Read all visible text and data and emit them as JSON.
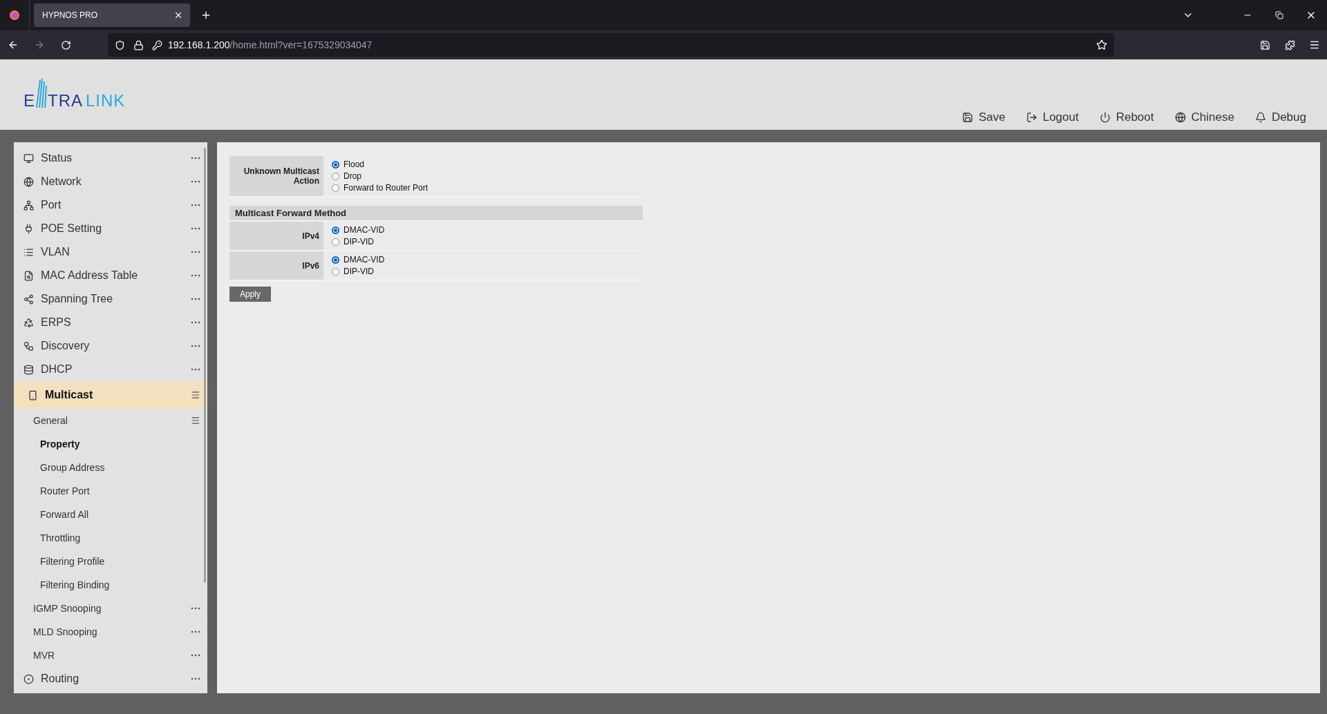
{
  "browser": {
    "tab_title": "HYPNOS PRO",
    "url_host": "192.168.1.200",
    "url_path": "/home.html?ver=1675329034047"
  },
  "logo": {
    "parts": [
      "E",
      "TRA",
      "LINK"
    ]
  },
  "header_actions": [
    "Save",
    "Logout",
    "Reboot",
    "Chinese",
    "Debug"
  ],
  "sidebar": {
    "items": [
      {
        "label": "Status",
        "expanded": false,
        "selected": false
      },
      {
        "label": "Network",
        "expanded": false,
        "selected": false
      },
      {
        "label": "Port",
        "expanded": false,
        "selected": false
      },
      {
        "label": "POE Setting",
        "expanded": false,
        "selected": false
      },
      {
        "label": "VLAN",
        "expanded": false,
        "selected": false
      },
      {
        "label": "MAC Address Table",
        "expanded": false,
        "selected": false
      },
      {
        "label": "Spanning Tree",
        "expanded": false,
        "selected": false
      },
      {
        "label": "ERPS",
        "expanded": false,
        "selected": false
      },
      {
        "label": "Discovery",
        "expanded": false,
        "selected": false
      },
      {
        "label": "DHCP",
        "expanded": false,
        "selected": false
      },
      {
        "label": "Multicast",
        "expanded": true,
        "selected": true,
        "children": [
          {
            "label": "General",
            "expanded": true,
            "selected": false,
            "children": [
              {
                "label": "Property",
                "selected": true
              },
              {
                "label": "Group Address",
                "selected": false
              },
              {
                "label": "Router Port",
                "selected": false
              },
              {
                "label": "Forward All",
                "selected": false
              },
              {
                "label": "Throttling",
                "selected": false
              },
              {
                "label": "Filtering Profile",
                "selected": false
              },
              {
                "label": "Filtering Binding",
                "selected": false
              }
            ]
          },
          {
            "label": "IGMP Snooping",
            "expanded": false,
            "selected": false
          },
          {
            "label": "MLD Snooping",
            "expanded": false,
            "selected": false
          },
          {
            "label": "MVR",
            "expanded": false,
            "selected": false
          }
        ]
      },
      {
        "label": "Routing",
        "expanded": false,
        "selected": false
      }
    ]
  },
  "form": {
    "rows": [
      {
        "kind": "radio",
        "label": "Unknown Multicast Action",
        "options": [
          {
            "label": "Flood",
            "selected": true
          },
          {
            "label": "Drop",
            "selected": false
          },
          {
            "label": "Forward to Router Port",
            "selected": false
          }
        ]
      },
      {
        "kind": "heading",
        "label": "Multicast Forward Method"
      },
      {
        "kind": "radio",
        "label": "IPv4",
        "options": [
          {
            "label": "DMAC-VID",
            "selected": true
          },
          {
            "label": "DIP-VID",
            "selected": false
          }
        ]
      },
      {
        "kind": "radio",
        "label": "IPv6",
        "options": [
          {
            "label": "DMAC-VID",
            "selected": true
          },
          {
            "label": "DIP-VID",
            "selected": false
          }
        ]
      }
    ],
    "apply_button": "Apply"
  }
}
